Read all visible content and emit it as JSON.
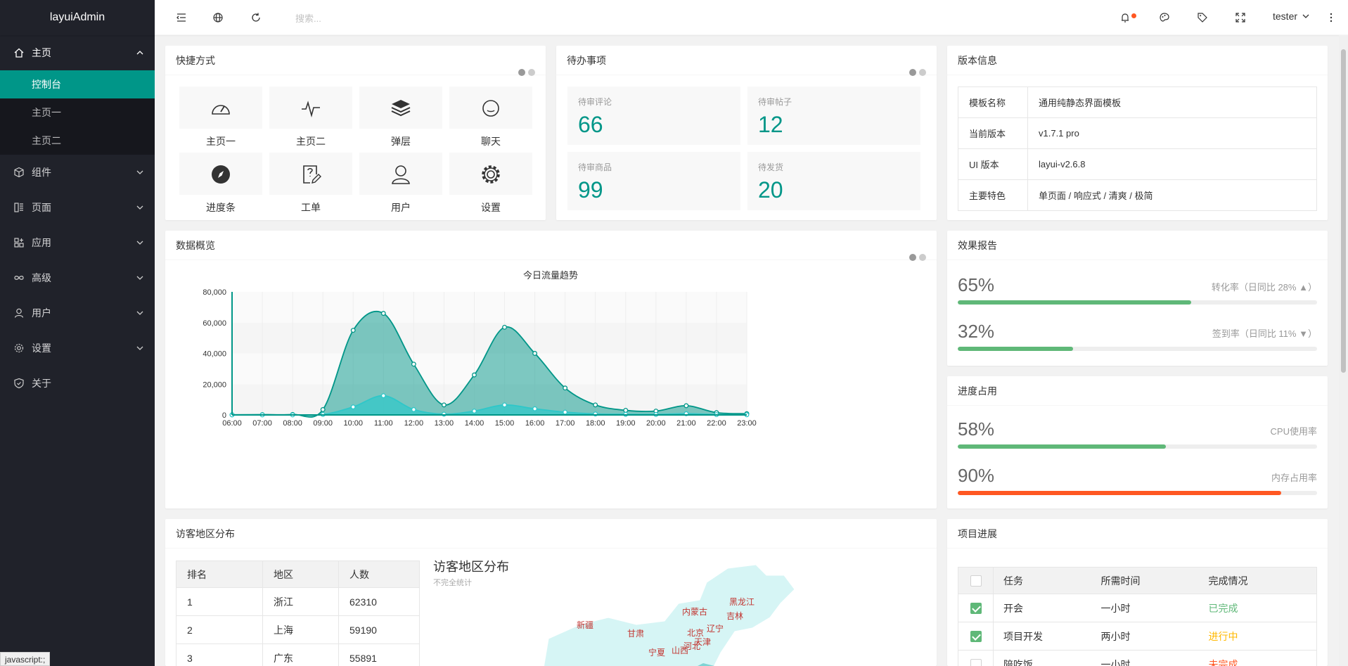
{
  "app": {
    "title": "layuiAdmin"
  },
  "sidebar": {
    "home": {
      "label": "主页",
      "children": [
        "控制台",
        "主页一",
        "主页二"
      ]
    },
    "items": [
      "组件",
      "页面",
      "应用",
      "高级",
      "用户",
      "设置",
      "关于"
    ]
  },
  "header": {
    "search_placeholder": "搜索...",
    "user": "tester"
  },
  "shortcuts": {
    "title": "快捷方式",
    "items": [
      {
        "label": "主页一",
        "icon": "dashboard-icon"
      },
      {
        "label": "主页二",
        "icon": "pulse-icon"
      },
      {
        "label": "弹层",
        "icon": "layers-icon"
      },
      {
        "label": "聊天",
        "icon": "chat-icon"
      },
      {
        "label": "进度条",
        "icon": "compass-icon"
      },
      {
        "label": "工单",
        "icon": "form-icon"
      },
      {
        "label": "用户",
        "icon": "user-icon"
      },
      {
        "label": "设置",
        "icon": "gear-icon"
      }
    ]
  },
  "todo": {
    "title": "待办事项",
    "items": [
      {
        "label": "待审评论",
        "value": "66"
      },
      {
        "label": "待审帖子",
        "value": "12"
      },
      {
        "label": "待审商品",
        "value": "99"
      },
      {
        "label": "待发货",
        "value": "20"
      }
    ]
  },
  "version": {
    "title": "版本信息",
    "rows": [
      {
        "k": "模板名称",
        "v": "通用纯静态界面模板"
      },
      {
        "k": "当前版本",
        "v": "v1.7.1 pro"
      },
      {
        "k": "UI 版本",
        "v": "layui-v2.6.8"
      },
      {
        "k": "主要特色",
        "v": "单页面 / 响应式 / 清爽 / 极简"
      }
    ]
  },
  "overview": {
    "title": "数据概览"
  },
  "report": {
    "title": "效果报告",
    "items": [
      {
        "pct": "65%",
        "desc": "转化率（日同比 28%",
        "trend": "up",
        "value": 0.65,
        "color": "#5fb878"
      },
      {
        "pct": "32%",
        "desc": "签到率（日同比 11%",
        "trend": "down",
        "value": 0.32,
        "color": "#5fb878"
      }
    ]
  },
  "progress": {
    "title": "进度占用",
    "items": [
      {
        "pct": "58%",
        "desc": "CPU使用率",
        "value": 0.58,
        "color": "#5fb878"
      },
      {
        "pct": "90%",
        "desc": "内存占用率",
        "value": 0.9,
        "color": "#ff5722"
      }
    ]
  },
  "region": {
    "title": "访客地区分布",
    "headers": [
      "排名",
      "地区",
      "人数"
    ],
    "rows": [
      [
        "1",
        "浙江",
        "62310"
      ],
      [
        "2",
        "上海",
        "59190"
      ],
      [
        "3",
        "广东",
        "55891"
      ]
    ],
    "map_title": "访客地区分布",
    "map_subtitle": "不完全统计",
    "map_labels": [
      "新疆",
      "甘肃",
      "内蒙古",
      "黑龙江",
      "吉林",
      "辽宁",
      "北京",
      "天津",
      "河北",
      "山西",
      "宁夏"
    ]
  },
  "project": {
    "title": "项目进展",
    "headers": [
      "任务",
      "所需时间",
      "完成情况"
    ],
    "rows": [
      {
        "task": "开会",
        "time": "一小时",
        "status": "已完成",
        "checked": true,
        "color": "#5fb878"
      },
      {
        "task": "项目开发",
        "time": "两小时",
        "status": "进行中",
        "checked": true,
        "color": "#ffb800"
      },
      {
        "task": "陪吃饭",
        "time": "一小时",
        "status": "未完成",
        "checked": false,
        "color": "#ff5722"
      }
    ]
  },
  "statusbar": "javascript:;",
  "chart_data": {
    "type": "area",
    "title": "今日流量趋势",
    "x": [
      "06:00",
      "07:00",
      "08:00",
      "09:00",
      "10:00",
      "11:00",
      "12:00",
      "13:00",
      "14:00",
      "15:00",
      "16:00",
      "17:00",
      "18:00",
      "19:00",
      "20:00",
      "21:00",
      "22:00",
      "23:00"
    ],
    "ylim": [
      0,
      80000
    ],
    "yticks": [
      "0",
      "20,000",
      "40,000",
      "60,000",
      "80,000"
    ],
    "series": [
      {
        "name": "",
        "color": "#009688",
        "values": [
          111,
          222,
          333,
          3500,
          55000,
          66000,
          33000,
          6500,
          26000,
          57000,
          40000,
          17500,
          6500,
          3000,
          2500,
          6000,
          1500,
          800
        ]
      },
      {
        "name": "",
        "color": "#2ec7c9",
        "values": [
          11,
          22,
          33,
          300,
          5200,
          12500,
          3500,
          500,
          2500,
          6500,
          4000,
          1800,
          600,
          400,
          300,
          800,
          200,
          100
        ]
      }
    ]
  }
}
